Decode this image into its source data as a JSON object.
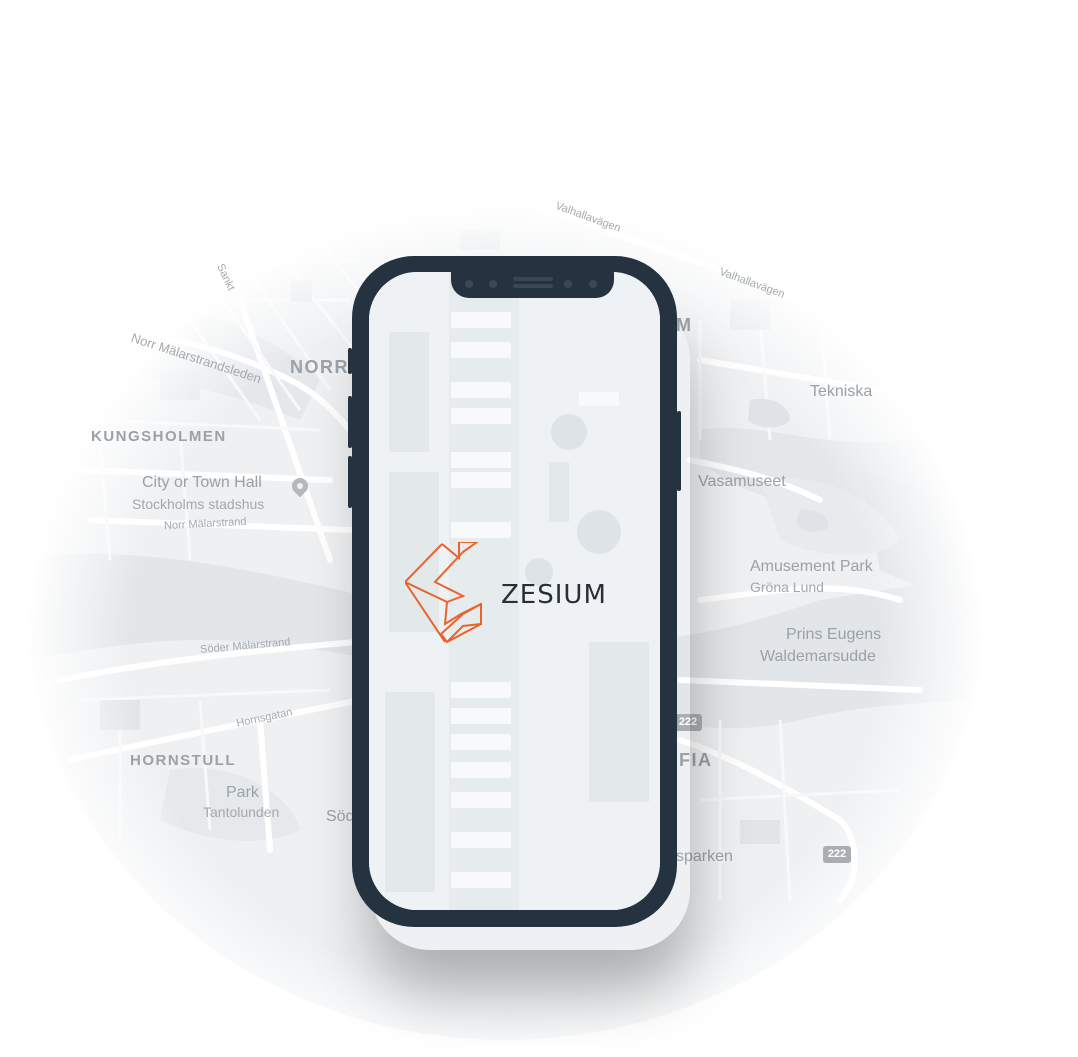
{
  "map": {
    "districts": {
      "kungsholmen": "KUNGSHOLMEN",
      "norr": "NORR",
      "hornstull": "HORNSTULL",
      "m": "M",
      "fia": "FIA"
    },
    "pois": {
      "city_hall": "City or Town Hall",
      "city_hall_sub": "Stockholms stadshus",
      "vasamuseet": "Vasamuseet",
      "amusement_park": "Amusement Park",
      "amusement_park_sub": "Gröna Lund",
      "prins_eugens": "Prins Eugens",
      "waldemarsudde": "Waldemarsudde",
      "park": "Park",
      "park_sub": "Tantolunden",
      "tekniska": "Tekniska",
      "sparken": "sparken",
      "sod": "Söd"
    },
    "streets": {
      "norr_malarstrand_long": "Norr Mälarstrandsleden",
      "norr_malarstrand": "Norr Mälarstrand",
      "soder_malarstrand": "Söder Mälarstrand",
      "hornsgatan": "Hornsgatan",
      "valhallavagen_1": "Valhallavägen",
      "valhallavagen_2": "Valhallavägen",
      "sankt": "Sankt"
    },
    "road_shields": [
      "222",
      "222"
    ],
    "colors": {
      "land": "#eef0f2",
      "water": "#e3e6e9",
      "park": "#e6e9ec",
      "road": "#ffffff"
    }
  },
  "phone": {
    "frame_color": "#25323f",
    "screen": {
      "brand_name": "ZESIUM",
      "brand_color": "#e8642c"
    }
  }
}
